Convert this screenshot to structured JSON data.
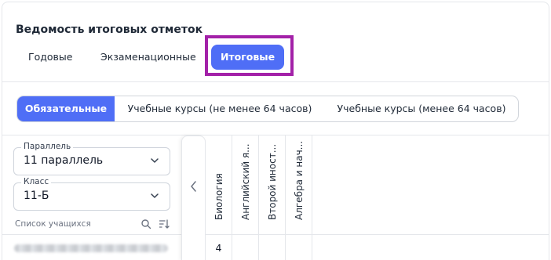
{
  "page": {
    "title": "Ведомость итоговых отметок"
  },
  "tabs": [
    {
      "label": "Годовые",
      "active": false
    },
    {
      "label": "Экзаменационные",
      "active": false
    },
    {
      "label": "Итоговые",
      "active": true
    }
  ],
  "course_filter": [
    {
      "label": "Обязательные",
      "active": true
    },
    {
      "label": "Учебные курсы (не менее 64 часов)",
      "active": false
    },
    {
      "label": "Учебные курсы (менее 64 часов)",
      "active": false
    }
  ],
  "filters": {
    "parallel": {
      "label": "Параллель",
      "value": "11 параллель"
    },
    "class": {
      "label": "Класс",
      "value": "11-Б"
    }
  },
  "student_list": {
    "label": "Список учащихся"
  },
  "subjects": [
    "Биология",
    "Английский я...",
    "Второй иност...",
    "Алгебра и нач..."
  ],
  "rows": [
    {
      "student": "",
      "grades": [
        "4",
        "",
        "",
        ""
      ]
    }
  ],
  "colors": {
    "accent": "#4f6ef6",
    "highlight_border": "#a321a8"
  },
  "icons": [
    "chevron-down-icon",
    "search-icon",
    "sort-icon",
    "chevron-left-icon"
  ]
}
